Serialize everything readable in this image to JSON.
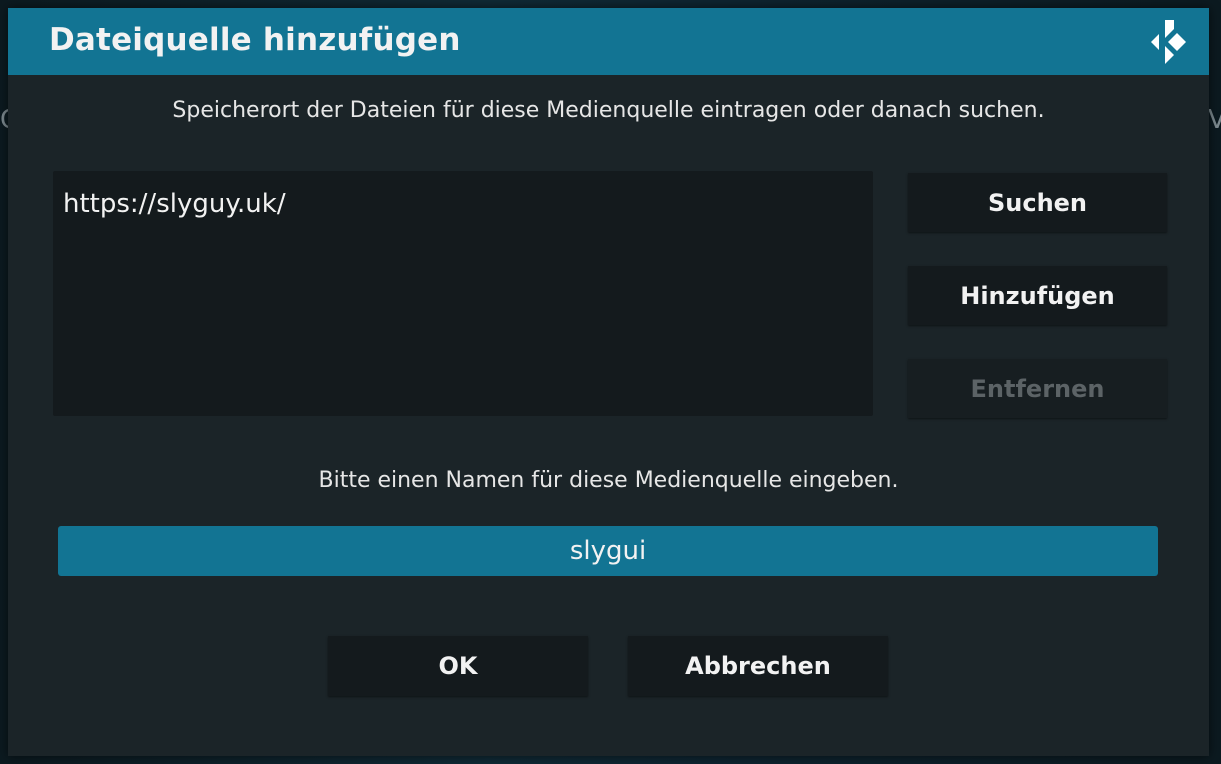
{
  "dialog": {
    "title": "Dateiquelle hinzufügen",
    "logo_icon": "kodi-logo-icon",
    "path_hint": "Speicherort der Dateien für diese Medienquelle eintragen oder danach suchen.",
    "paths": [
      "https://slyguy.uk/"
    ],
    "buttons": {
      "browse": "Suchen",
      "add": "Hinzufügen",
      "remove": "Entfernen"
    },
    "name_hint": "Bitte einen Namen für diese Medienquelle eingeben.",
    "name_value": "slygui",
    "ok_label": "OK",
    "cancel_label": "Abbrechen"
  },
  "colors": {
    "accent": "#127493",
    "dialog_bg": "#1b2428",
    "button_bg": "#141a1d",
    "disabled_text": "#5c6366"
  }
}
